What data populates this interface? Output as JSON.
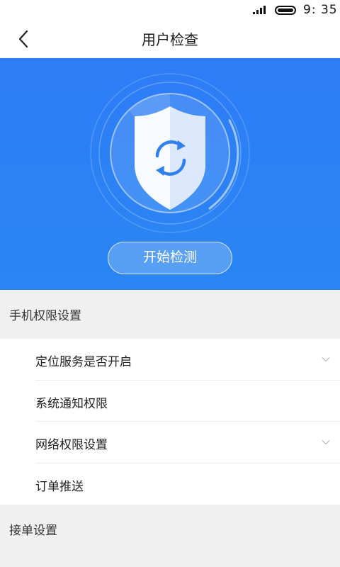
{
  "status_bar": {
    "time": "9: 35"
  },
  "header": {
    "title": "用户检查"
  },
  "hero": {
    "start_button": "开始检测"
  },
  "sections": [
    {
      "title": "手机权限设置",
      "items": [
        {
          "label": "定位服务是否开启",
          "icon": "chevron-down-icon"
        },
        {
          "label": "系统通知权限"
        },
        {
          "label": "网络权限设置",
          "icon": "chevron-down-icon"
        },
        {
          "label": "订单推送"
        }
      ]
    },
    {
      "title": "接单设置"
    }
  ],
  "colors": {
    "hero_blue": "#2e7cf6",
    "background": "#f0f0f0"
  }
}
